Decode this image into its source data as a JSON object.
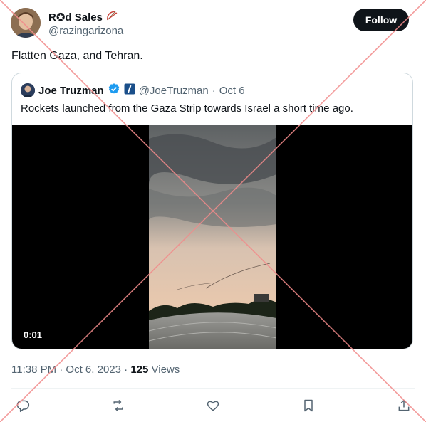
{
  "post": {
    "author_name": "R✪d Sales",
    "author_handle": "@razingarizona",
    "follow_label": "Follow",
    "text": "Flatten Gaza, and Tehran.",
    "time": "11:38 PM · Oct 6, 2023 ·",
    "views_count": "125",
    "views_label": "Views"
  },
  "quoted": {
    "author_name": "Joe Truzman",
    "author_handle": "@JoeTruzman",
    "separator": "·",
    "date": "Oct 6",
    "text": "Rockets launched from the Gaza Strip towards Israel a short time ago.",
    "video_time": "0:01"
  },
  "actions": [
    "reply-icon",
    "repost-icon",
    "like-icon",
    "bookmark-icon",
    "share-icon"
  ],
  "colors": {
    "text": "#0f1419",
    "secondary": "#536471",
    "verified": "#1d9bf0",
    "overlay_x": "#f28b8b",
    "follow_bg": "#0f1419"
  }
}
